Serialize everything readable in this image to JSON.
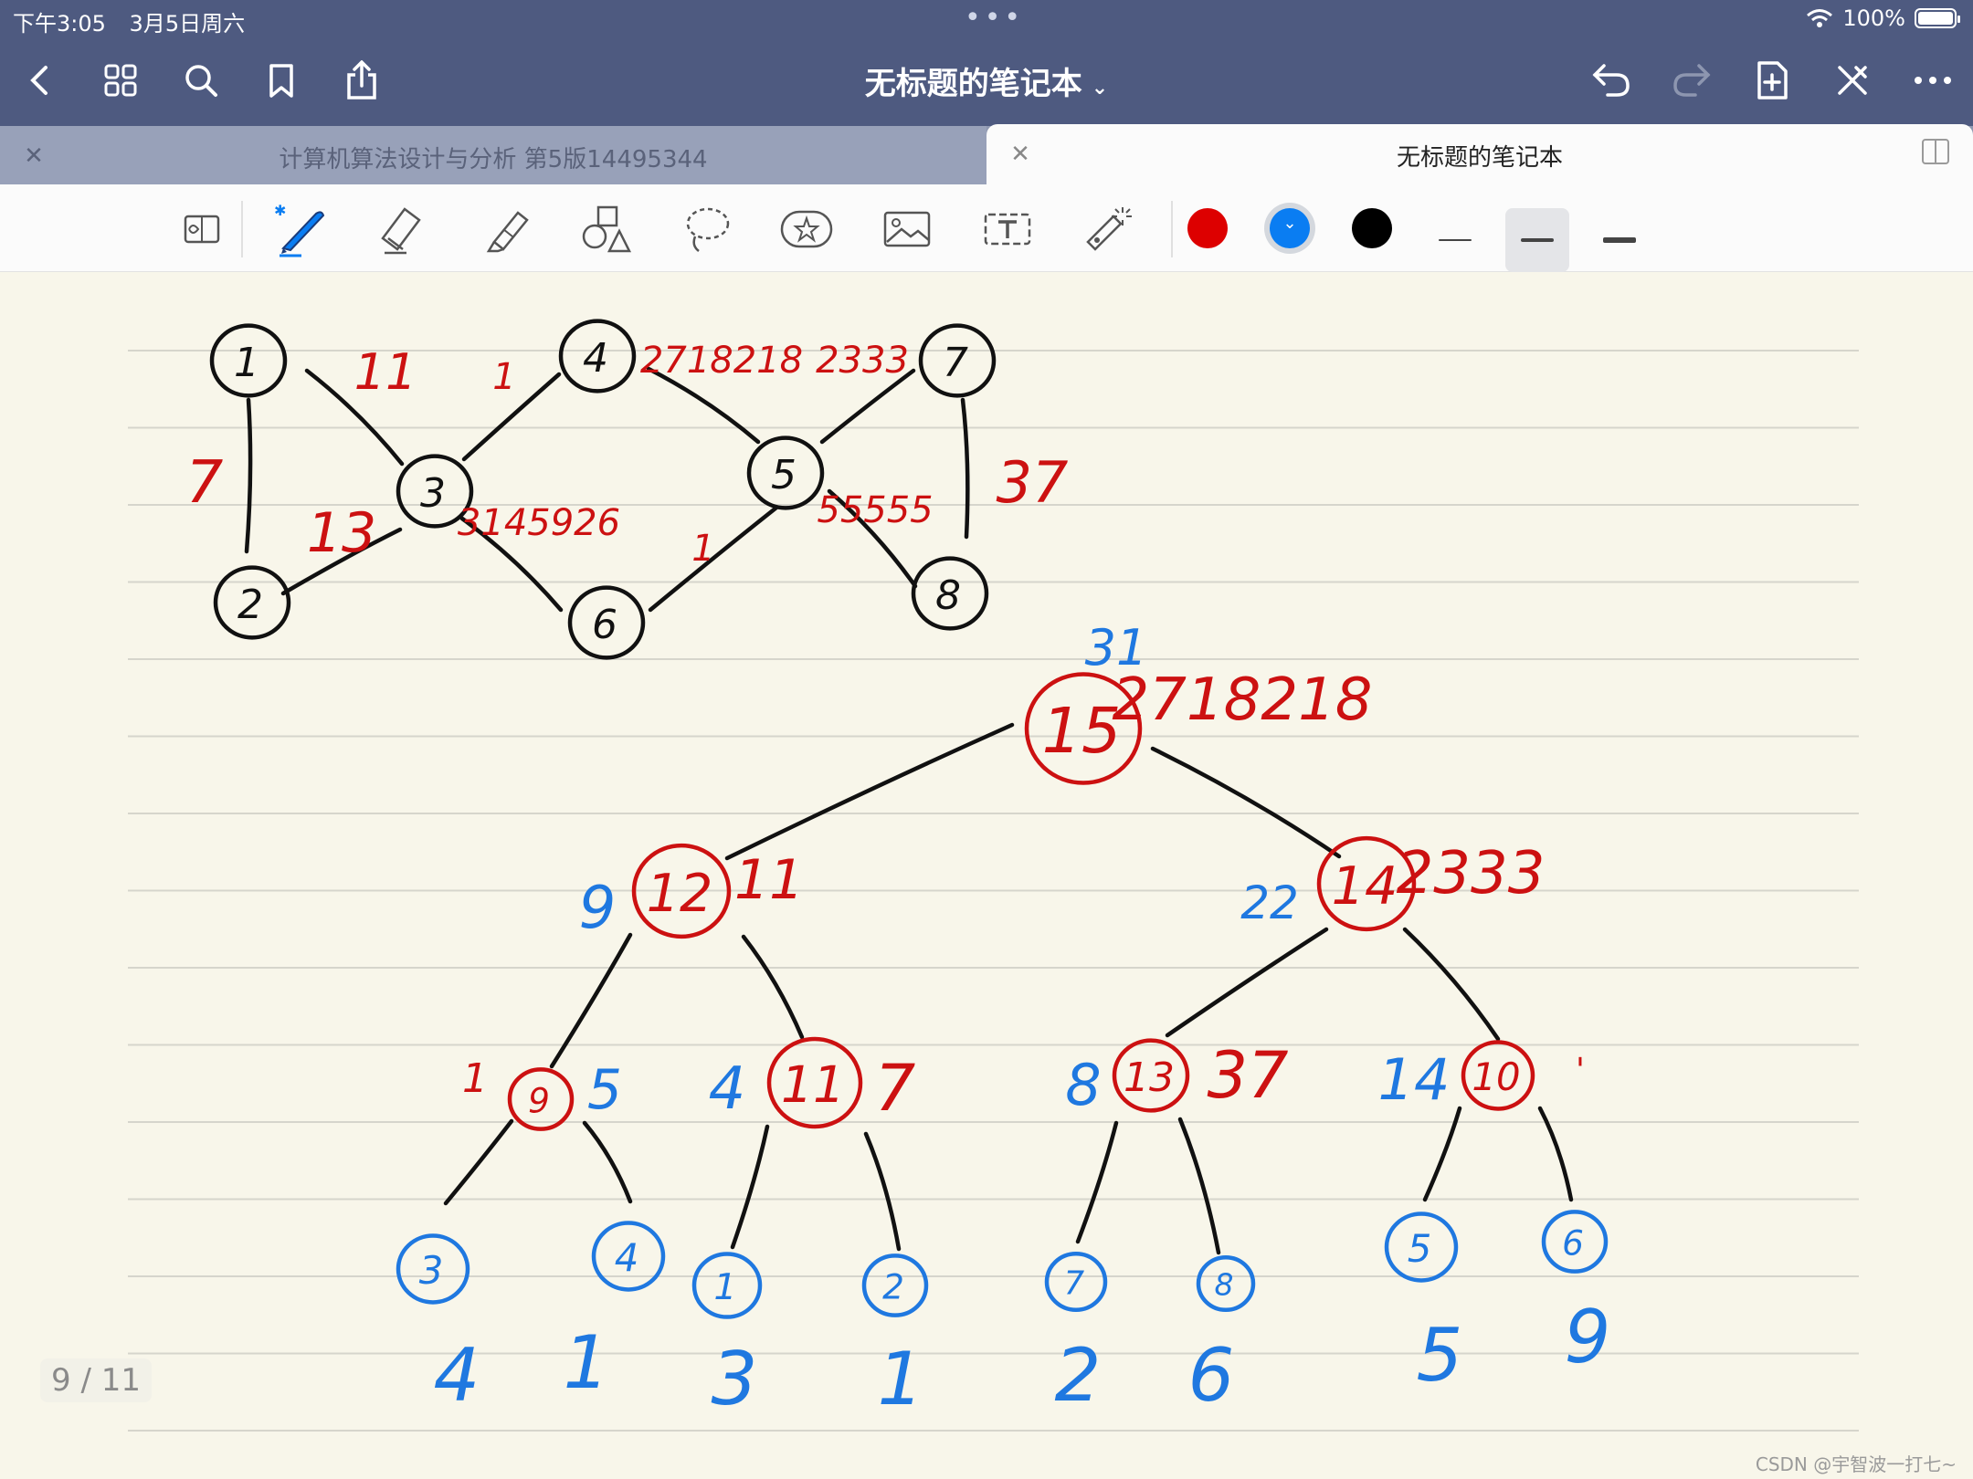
{
  "status": {
    "time": "下午3:05",
    "date": "3月5日周六",
    "battery": "100%"
  },
  "navbar": {
    "title": "无标题的笔记本",
    "icons": [
      "back-icon",
      "grid-icon",
      "search-icon",
      "bookmark-icon",
      "share-icon",
      "undo-icon",
      "redo-icon",
      "add-page-icon",
      "close-pen-icon",
      "more-icon"
    ]
  },
  "tabs": [
    {
      "label": "计算机算法设计与分析 第5版14495344",
      "active": false
    },
    {
      "label": "无标题的笔记本",
      "active": true
    }
  ],
  "toolbar": {
    "tools": [
      "read-mode",
      "pen",
      "eraser",
      "highlighter",
      "shapes",
      "lasso",
      "sticker",
      "image",
      "text",
      "laser-pointer"
    ],
    "colors": [
      "#dd0000",
      "#0a7df2",
      "#000000"
    ],
    "selected_color": "#0a7df2",
    "selected_width_index": 1
  },
  "page": {
    "indicator": "9 / 11",
    "watermark": "CSDN @宇智波一打七~"
  },
  "graph": {
    "nodes": [
      {
        "label": "1"
      },
      {
        "label": "2"
      },
      {
        "label": "3"
      },
      {
        "label": "4"
      },
      {
        "label": "5"
      },
      {
        "label": "6"
      },
      {
        "label": "7"
      },
      {
        "label": "8"
      }
    ],
    "edge_labels": [
      "11",
      "7",
      "13",
      "1",
      "2718218",
      "3145926",
      "1",
      "2333",
      "37",
      "55555"
    ]
  },
  "tree": {
    "nodes": [
      {
        "label": "15",
        "color": "red",
        "left_note": "31",
        "right_note": "2718218"
      },
      {
        "label": "12",
        "color": "red",
        "left_note": "9",
        "right_note": "11"
      },
      {
        "label": "14",
        "color": "red",
        "left_note": "22",
        "right_note": "2333"
      },
      {
        "label": "9",
        "color": "red",
        "left_note": "1",
        "right_note": "5"
      },
      {
        "label": "11",
        "color": "red",
        "left_note": "4",
        "right_note": "7"
      },
      {
        "label": "13",
        "color": "red",
        "left_note": "8",
        "right_note": "37"
      },
      {
        "label": "10",
        "color": "red",
        "left_note": "14",
        "right_note": "'"
      },
      {
        "label": "3",
        "color": "blue",
        "below": "4"
      },
      {
        "label": "4",
        "color": "blue",
        "below": "1"
      },
      {
        "label": "1",
        "color": "blue",
        "below": "3"
      },
      {
        "label": "2",
        "color": "blue",
        "below": "1"
      },
      {
        "label": "7",
        "color": "blue",
        "below": "2"
      },
      {
        "label": "8",
        "color": "blue",
        "below": "6"
      },
      {
        "label": "5",
        "color": "blue",
        "below": "5"
      },
      {
        "label": "6",
        "color": "blue",
        "below": "9"
      }
    ]
  }
}
